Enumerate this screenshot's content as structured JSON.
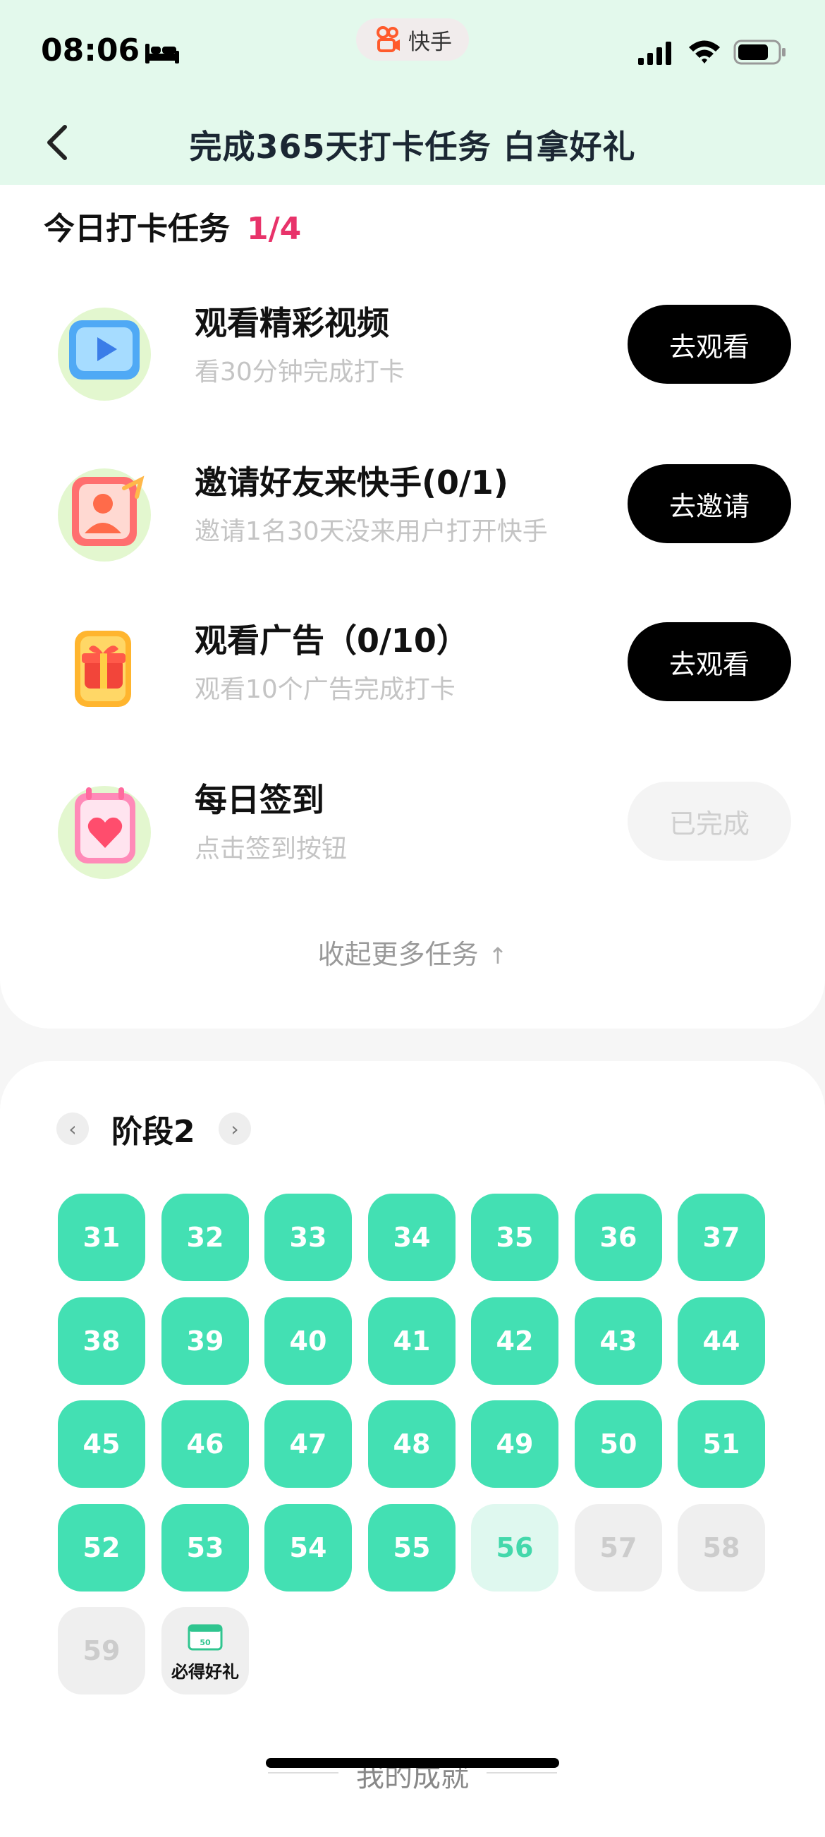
{
  "status_bar": {
    "time": "08:06",
    "app_name": "快手"
  },
  "header": {
    "title": "完成365天打卡任务 白拿好礼"
  },
  "tasks_section": {
    "title": "今日打卡任务",
    "count": "1/4",
    "collapse_label": "收起更多任务",
    "items": [
      {
        "title": "观看精彩视频",
        "subtitle": "看30分钟完成打卡",
        "button": "去观看",
        "icon": "video-play-icon"
      },
      {
        "title": "邀请好友来快手(0/1)",
        "subtitle": "邀请1名30天没来用户打开快手",
        "button": "去邀请",
        "icon": "invite-friend-icon"
      },
      {
        "title": "观看广告（0/10）",
        "subtitle": "观看10个广告完成打卡",
        "button": "去观看",
        "icon": "gift-box-icon"
      },
      {
        "title": "每日签到",
        "subtitle": "点击签到按钮",
        "button": "已完成",
        "icon": "heart-calendar-icon"
      }
    ]
  },
  "stage": {
    "title": "阶段2",
    "days_done": [
      "31",
      "32",
      "33",
      "34",
      "35",
      "36",
      "37",
      "38",
      "39",
      "40",
      "41",
      "42",
      "43",
      "44",
      "45",
      "46",
      "47",
      "48",
      "49",
      "50",
      "51",
      "52",
      "53",
      "54",
      "55"
    ],
    "day_current": "56",
    "days_future": [
      "57",
      "58",
      "59"
    ],
    "gift": {
      "badge": "50",
      "label": "必得好礼"
    }
  },
  "footer": {
    "achievement": "我的成就"
  },
  "colors": {
    "header_bg": "#e3f9ec",
    "accent_green": "#43e0b3",
    "count_red": "#e8336a",
    "button_black": "#000000"
  }
}
